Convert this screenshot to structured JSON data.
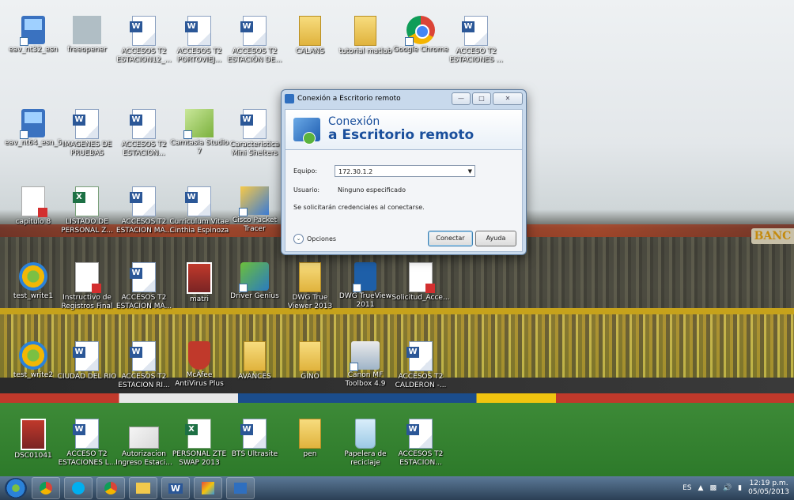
{
  "desktop_icons": [
    {
      "label": "eav_nt32_esn",
      "type": "setup"
    },
    {
      "label": "freeopener",
      "type": "anti"
    },
    {
      "label": "ACCESOS T2 ESTACION12_...",
      "type": "doc"
    },
    {
      "label": "ACCESOS T2 PORTOVIEJ...",
      "type": "doc"
    },
    {
      "label": "ACCESOS T2 ESTACIÓN DE...",
      "type": "doc"
    },
    {
      "label": "CALANS",
      "type": "folder"
    },
    {
      "label": "tutorial matlab",
      "type": "folder"
    },
    {
      "label": "Google Chrome",
      "type": "chrome"
    },
    {
      "label": "ACCESO T2 ESTACIONES ...",
      "type": "doc"
    },
    {
      "label": "eav_nt64_esn_5",
      "type": "setup"
    },
    {
      "label": "IMAGENES DE PRUEBAS",
      "type": "doc"
    },
    {
      "label": "ACCESOS T2 ESTACION...",
      "type": "doc"
    },
    {
      "label": "Camtasia Studio 7",
      "type": "green"
    },
    {
      "label": "Caracteristica Mini Shelters",
      "type": "doc"
    },
    {
      "label": "capitulo 8",
      "type": "pdf"
    },
    {
      "label": "LISTADO DE PERSONAL Z...",
      "type": "xls"
    },
    {
      "label": "ACCESOS T2 ESTACION MA...",
      "type": "doc"
    },
    {
      "label": "Curriculum Vitae Cinthia Espinoza",
      "type": "doc"
    },
    {
      "label": "Cisco Packet Tracer",
      "type": "tool"
    },
    {
      "label": "test_write1",
      "type": "win"
    },
    {
      "label": "Instructivo de Registros Final",
      "type": "pdf"
    },
    {
      "label": "ACCESOS T2 ESTACION MA...",
      "type": "doc"
    },
    {
      "label": "matri",
      "type": "photo"
    },
    {
      "label": "Driver Genius",
      "type": "driver"
    },
    {
      "label": "DWG True Viewer 2013",
      "type": "folder"
    },
    {
      "label": "DWG TrueView 2011",
      "type": "dwg"
    },
    {
      "label": "Solicitud_Acce...",
      "type": "pdf"
    },
    {
      "label": "test_write2",
      "type": "win"
    },
    {
      "label": "CIUDAD DEL RIO",
      "type": "doc"
    },
    {
      "label": "ACCESOS T2 ESTACION RI...",
      "type": "doc"
    },
    {
      "label": "McAfee AntiVirus Plus",
      "type": "mcafee"
    },
    {
      "label": "AVANCES",
      "type": "folder"
    },
    {
      "label": "GINO",
      "type": "folder"
    },
    {
      "label": "Canon MF Toolbox 4.9",
      "type": "printer"
    },
    {
      "label": "ACCESOS T2 CALDERON -...",
      "type": "doc"
    },
    {
      "label": "DSC01041",
      "type": "photo"
    },
    {
      "label": "ACCESO T2 ESTACIONES L...",
      "type": "doc"
    },
    {
      "label": "Autorizacion Ingreso Estaci...",
      "type": "mail"
    },
    {
      "label": "PERSONAL ZTE SWAP 2013",
      "type": "xls"
    },
    {
      "label": "BTS Ultrasite",
      "type": "doc"
    },
    {
      "label": "pen",
      "type": "folder"
    },
    {
      "label": "Papelera de reciclaje",
      "type": "recycle"
    },
    {
      "label": "ACCESOS T2 ESTACION...",
      "type": "doc"
    }
  ],
  "wallpaper": {
    "sign": "BANC"
  },
  "rdp": {
    "title": "Conexión a Escritorio remoto",
    "banner_line1": "Conexión",
    "banner_line2": "a Escritorio remoto",
    "equipo_label": "Equipo:",
    "equipo_value": "172.30.1.2",
    "usuario_label": "Usuario:",
    "usuario_value": "Ninguno especificado",
    "note": "Se solicitarán credenciales al conectarse.",
    "options_label": "Opciones",
    "connect_label": "Conectar",
    "help_label": "Ayuda"
  },
  "taskbar": {
    "apps": [
      "chrome",
      "skype",
      "chrome",
      "explorer",
      "word",
      "paint",
      "rdp"
    ],
    "word_label": "W",
    "lang": "ES",
    "time": "12:19 p.m.",
    "date": "05/05/2013"
  }
}
